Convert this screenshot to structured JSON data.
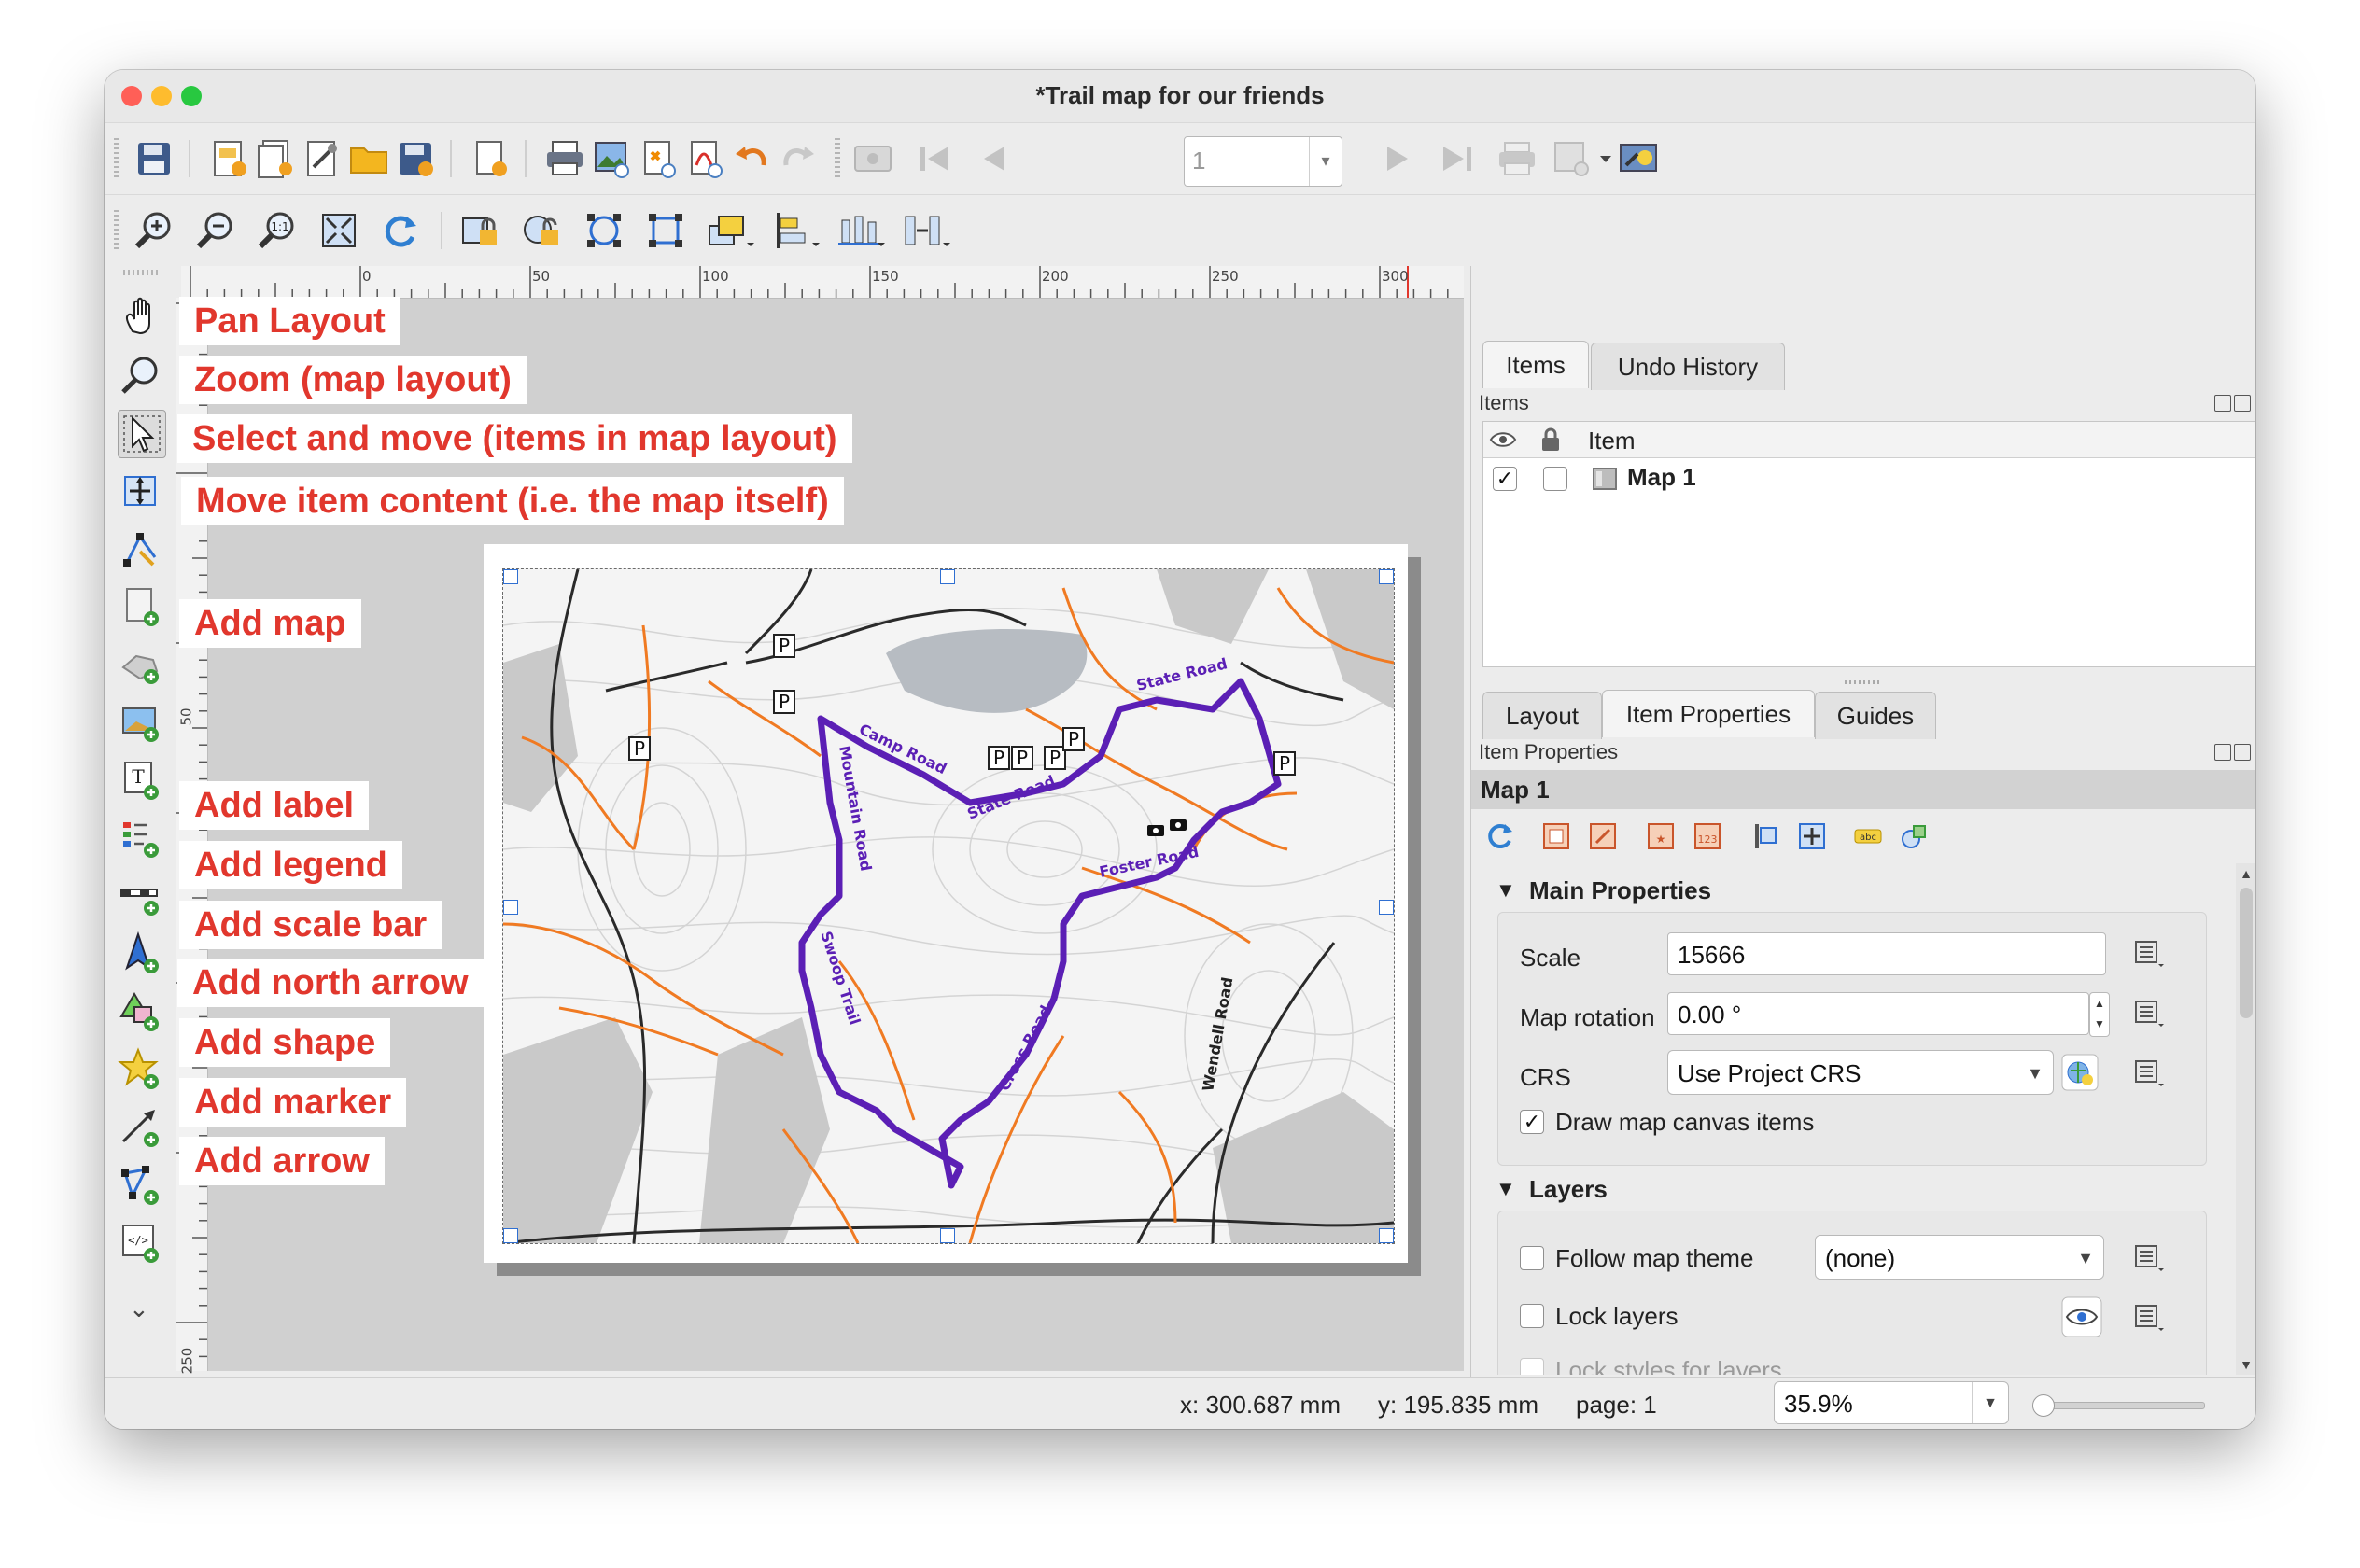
{
  "window": {
    "title": "*Trail map for our friends"
  },
  "annotations": [
    "Pan Layout",
    "Zoom (map layout)",
    "Select and move (items in map layout)",
    "Move item content (i.e. the map itself)",
    "Add map",
    "Add label",
    "Add legend",
    "Add scale bar",
    "Add north arrow",
    "Add shape",
    "Add marker",
    "Add arrow"
  ],
  "toolbar": {
    "page_number": "1"
  },
  "ruler": {
    "top_labels": [
      "0",
      "50",
      "100",
      "150",
      "200",
      "250",
      "300"
    ],
    "left_labels": [
      "50",
      "250"
    ]
  },
  "map": {
    "road_labels": [
      "Camp Road",
      "Mountain Road",
      "State Road",
      "State Road",
      "Foster Road",
      "Swoop Trail",
      "Cross Road",
      "Wendell Road"
    ],
    "parking_symbol": "P"
  },
  "panel": {
    "top_tabs": [
      "Items",
      "Undo History"
    ],
    "items_header": "Items",
    "items_column": "Item",
    "items": [
      {
        "name": "Map 1",
        "visible": true,
        "locked": false
      }
    ],
    "bottom_tabs": [
      "Layout",
      "Item Properties",
      "Guides"
    ],
    "props_header": "Item Properties",
    "selected_item": "Map 1",
    "main_properties": {
      "title": "Main Properties",
      "scale_label": "Scale",
      "scale_value": "15666",
      "rotation_label": "Map rotation",
      "rotation_value": "0.00 °",
      "crs_label": "CRS",
      "crs_value": "Use Project CRS",
      "draw_canvas_label": "Draw map canvas items",
      "draw_canvas_checked": true
    },
    "layers": {
      "title": "Layers",
      "follow_theme_label": "Follow map theme",
      "follow_theme_value": "(none)",
      "lock_layers_label": "Lock layers",
      "lock_styles_label": "Lock styles for layers"
    }
  },
  "status": {
    "x": "x: 300.687 mm",
    "y": "y: 195.835 mm",
    "page": "page: 1",
    "zoom": "35.9%"
  },
  "colors": {
    "annotation_text": "#e1372d",
    "trail": "#5b1fb5",
    "road_orange": "#f07a22"
  }
}
